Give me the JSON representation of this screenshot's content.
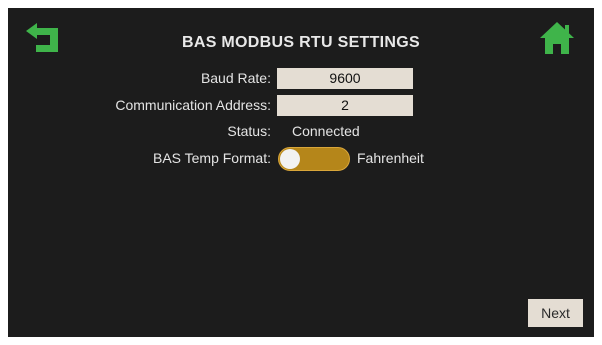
{
  "header": {
    "title": "BAS MODBUS RTU SETTINGS",
    "back_icon": "back-arrow-icon",
    "home_icon": "home-icon"
  },
  "settings": {
    "baud_rate": {
      "label": "Baud Rate:",
      "value": "9600"
    },
    "communication_address": {
      "label": "Communication Address:",
      "value": "2"
    },
    "status": {
      "label": "Status:",
      "value": "Connected"
    },
    "temp_format": {
      "label": "BAS Temp Format:",
      "value": "Fahrenheit"
    }
  },
  "footer": {
    "next_label": "Next"
  },
  "colors": {
    "background": "#1c1c1c",
    "accent_green": "#3fb44a",
    "toggle_gold": "#b5861a",
    "field_bg": "#e4ddd3"
  }
}
